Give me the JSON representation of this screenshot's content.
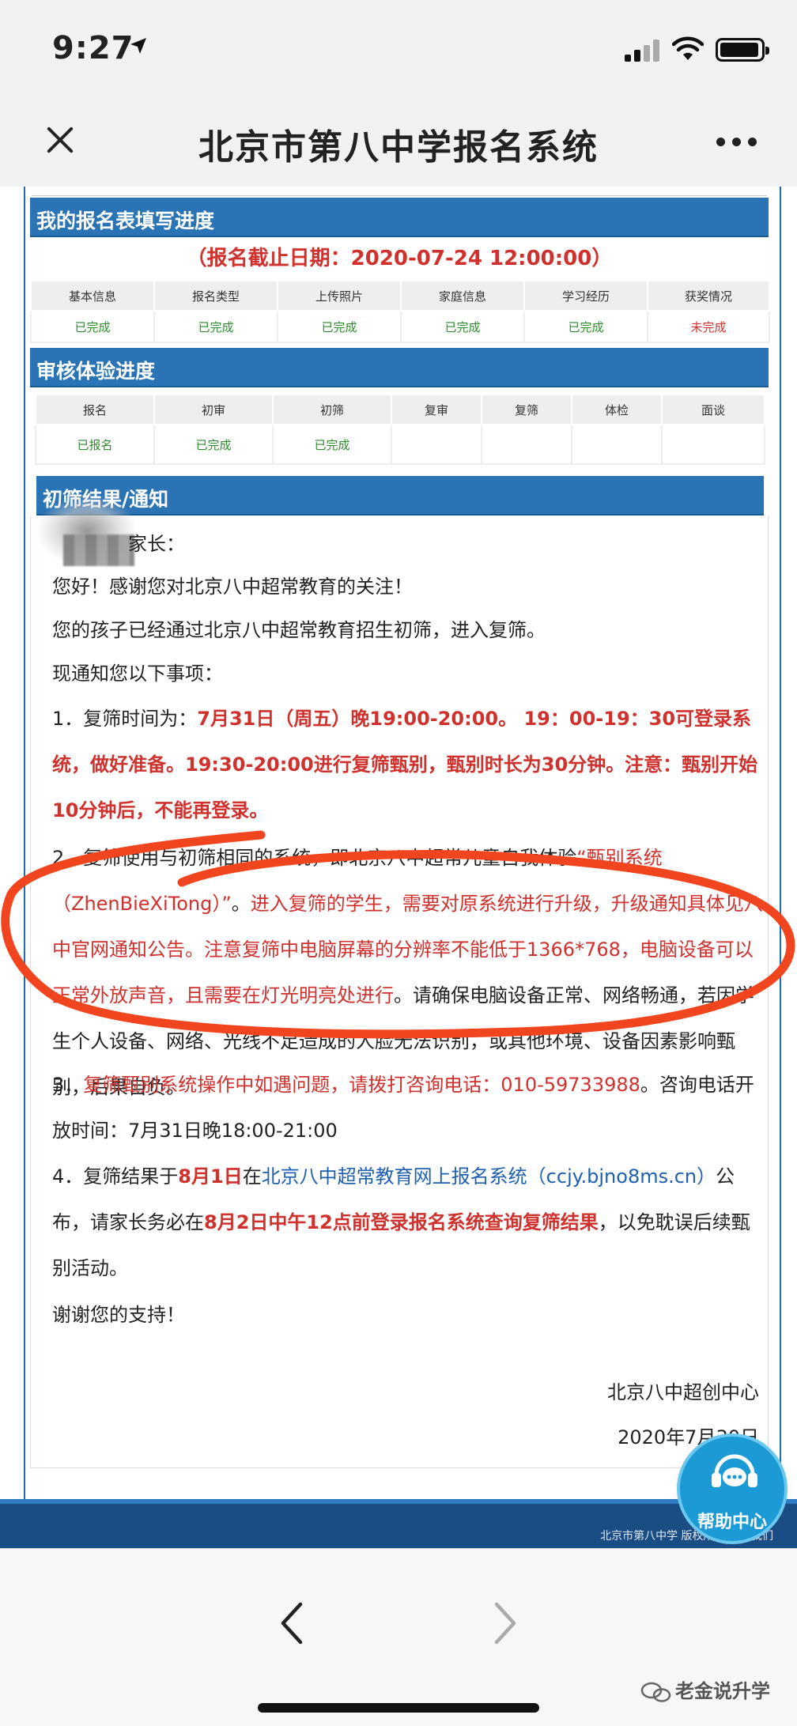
{
  "status_bar": {
    "time": "9:27"
  },
  "nav": {
    "title": "北京市第八中学报名系统"
  },
  "form_progress": {
    "heading": "我的报名表填写进度",
    "deadline": "（报名截止日期：2020-07-24 12:00:00）",
    "columns": [
      "基本信息",
      "报名类型",
      "上传照片",
      "家庭信息",
      "学习经历",
      "获奖情况"
    ],
    "statuses": [
      "已完成",
      "已完成",
      "已完成",
      "已完成",
      "已完成",
      "未完成"
    ]
  },
  "review_progress": {
    "heading": "审核体验进度",
    "columns": [
      "报名",
      "初审",
      "初筛",
      "复审",
      "复筛",
      "体检",
      "面谈"
    ],
    "statuses": [
      "已报名",
      "已完成",
      "已完成",
      "",
      "",
      "",
      ""
    ]
  },
  "notice": {
    "heading": "初筛结果/通知",
    "salutation": "家长：",
    "greeting": "您好！感谢您对北京八中超常教育的关注！",
    "passed": "您的孩子已经通过北京八中超常教育招生初筛，进入复筛。",
    "intro": "现通知您以下事项：",
    "item1_prefix": "1．复筛时间为：",
    "item1_red": "7月31日（周五）晚19:00-20:00。 19：00-19：30可登录系统，做好准备。19:30-20:00进行复筛甄别，甄别时长为30分钟。注意：甄别开始10分钟后，不能再登录。",
    "item2_prefix": "2．复筛使用与初筛相同的系统，即北京八中超常儿童自我体验",
    "item2_red1": "“甄别系统（ZhenBieXiTong）”",
    "item2_mid": "。",
    "item2_red2": "进入复筛的学生，需要对原系统进行升级，升级通知具体见八中官网通知公告。注意复筛中电脑屏幕的分辨率不能低于1366*768，电脑设备可以正常外放声音，且需要在灯光明亮处进行",
    "item2_rest": "。请确保电脑设备正常、网络畅通，若因学生个人设备、网络、光线不足造成的人脸无法识别，或其他环境、设备因素影响甄别，后果自负。",
    "item3_prefix": "3．",
    "item3_red": "复筛甄别系统操作中如遇问题，请拨打咨询电话：010-59733988",
    "item3_rest": "。咨询电话开放时间：7月31日晚18:00-21:00",
    "item4_prefix": "4．复筛结果于",
    "item4_red1": "8月1日",
    "item4_mid1": "在",
    "item4_blue": "北京八中超常教育网上报名系统（ccjy.bjno8ms.cn）",
    "item4_mid2": "公布，请家长务必在",
    "item4_red2": "8月2日中午12点前登录报名系统查询复筛结果",
    "item4_rest": "，以免耽误后续甄别活动。",
    "thanks": "谢谢您的支持！",
    "signature": "北京八中超创中心",
    "date": "2020年7月30日"
  },
  "footer": {
    "text": "北京市第八中学   版权所有       联系我们"
  },
  "help": {
    "label": "帮助中心"
  },
  "watermark": {
    "text": "老金说升学"
  },
  "colors": {
    "accent_blue": "#2a73b5",
    "red": "#d0312d",
    "green": "#2e8b2e",
    "annotation_red": "#f0451e"
  }
}
